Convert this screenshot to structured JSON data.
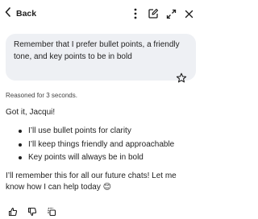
{
  "header": {
    "back_label": "Back",
    "icons": [
      "chevron-left-icon",
      "more-vertical-icon",
      "edit-icon",
      "expand-icon",
      "close-icon"
    ]
  },
  "user_message": {
    "text": "Remember that I prefer bullet points, a friendly tone, and key points to be in bold"
  },
  "assistant": {
    "reasoned_label": "Reasoned for 3 seconds.",
    "greeting": "Got it, Jacqui!",
    "bullets": [
      "I’ll use bullet points for clarity",
      "I’ll keep things friendly and approachable",
      "Key points will always be in bold"
    ],
    "closing": "I’ll remember this for all our future chats! Let me know how I can help today 😊"
  },
  "feedback_icons": [
    "thumbs-up-icon",
    "thumbs-down-icon",
    "copy-icon"
  ]
}
